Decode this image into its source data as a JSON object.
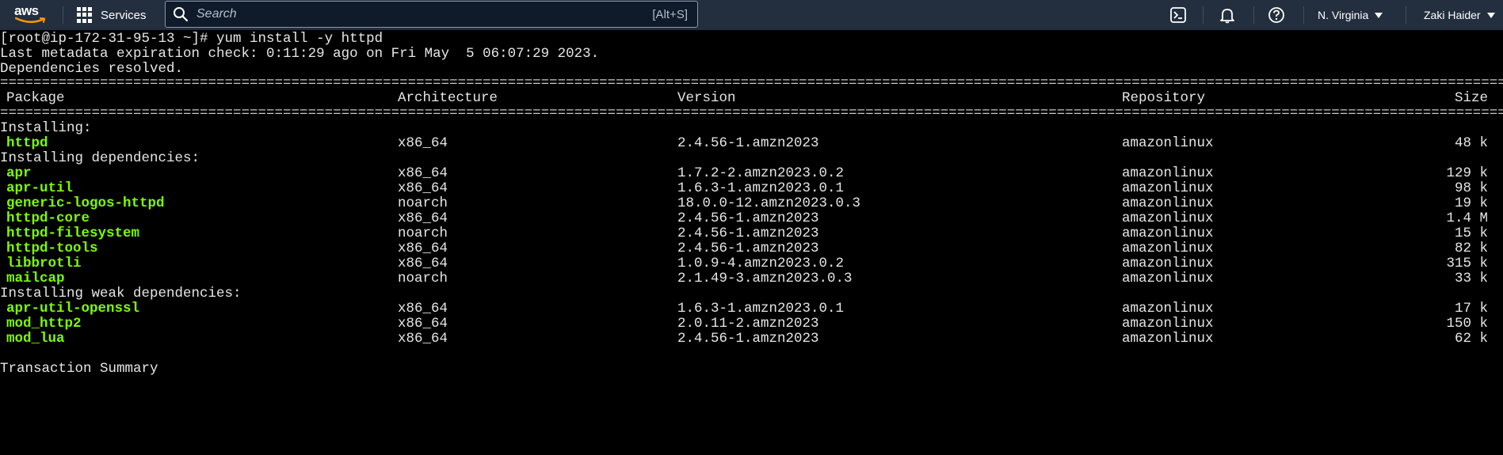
{
  "nav": {
    "logo_text": "aws",
    "services_label": "Services",
    "search_placeholder": "Search",
    "search_shortcut": "[Alt+S]",
    "region": "N. Virginia",
    "user": "Zaki Haider",
    "icons": [
      "cloudshell-icon",
      "bell-icon",
      "help-icon"
    ]
  },
  "terminal": {
    "prompt_line": "[root@ip-172-31-95-13 ~]# yum install -y httpd",
    "metadata_line": "Last metadata expiration check: 0:11:29 ago on Fri May  5 06:07:29 2023.",
    "deps_resolved": "Dependencies resolved.",
    "rule": "================================================================================================================================================================================================================",
    "headers": {
      "package": "Package",
      "arch": "Architecture",
      "version": "Version",
      "repo": "Repository",
      "size": "Size"
    },
    "section_installing": "Installing:",
    "installing": [
      {
        "name": "httpd",
        "arch": "x86_64",
        "version": "2.4.56-1.amzn2023",
        "repo": "amazonlinux",
        "size": "48 k"
      }
    ],
    "section_deps": "Installing dependencies:",
    "dependencies": [
      {
        "name": "apr",
        "arch": "x86_64",
        "version": "1.7.2-2.amzn2023.0.2",
        "repo": "amazonlinux",
        "size": "129 k"
      },
      {
        "name": "apr-util",
        "arch": "x86_64",
        "version": "1.6.3-1.amzn2023.0.1",
        "repo": "amazonlinux",
        "size": "98 k"
      },
      {
        "name": "generic-logos-httpd",
        "arch": "noarch",
        "version": "18.0.0-12.amzn2023.0.3",
        "repo": "amazonlinux",
        "size": "19 k"
      },
      {
        "name": "httpd-core",
        "arch": "x86_64",
        "version": "2.4.56-1.amzn2023",
        "repo": "amazonlinux",
        "size": "1.4 M"
      },
      {
        "name": "httpd-filesystem",
        "arch": "noarch",
        "version": "2.4.56-1.amzn2023",
        "repo": "amazonlinux",
        "size": "15 k"
      },
      {
        "name": "httpd-tools",
        "arch": "x86_64",
        "version": "2.4.56-1.amzn2023",
        "repo": "amazonlinux",
        "size": "82 k"
      },
      {
        "name": "libbrotli",
        "arch": "x86_64",
        "version": "1.0.9-4.amzn2023.0.2",
        "repo": "amazonlinux",
        "size": "315 k"
      },
      {
        "name": "mailcap",
        "arch": "noarch",
        "version": "2.1.49-3.amzn2023.0.3",
        "repo": "amazonlinux",
        "size": "33 k"
      }
    ],
    "section_weak": "Installing weak dependencies:",
    "weak_dependencies": [
      {
        "name": "apr-util-openssl",
        "arch": "x86_64",
        "version": "1.6.3-1.amzn2023.0.1",
        "repo": "amazonlinux",
        "size": "17 k"
      },
      {
        "name": "mod_http2",
        "arch": "x86_64",
        "version": "2.0.11-2.amzn2023",
        "repo": "amazonlinux",
        "size": "150 k"
      },
      {
        "name": "mod_lua",
        "arch": "x86_64",
        "version": "2.4.56-1.amzn2023",
        "repo": "amazonlinux",
        "size": "62 k"
      }
    ],
    "transaction_summary": "Transaction Summary"
  },
  "colors": {
    "nav_bg": "#232f3e",
    "terminal_bg": "#000000",
    "terminal_text": "#e6e6e6",
    "package_green": "#7cfc00"
  }
}
